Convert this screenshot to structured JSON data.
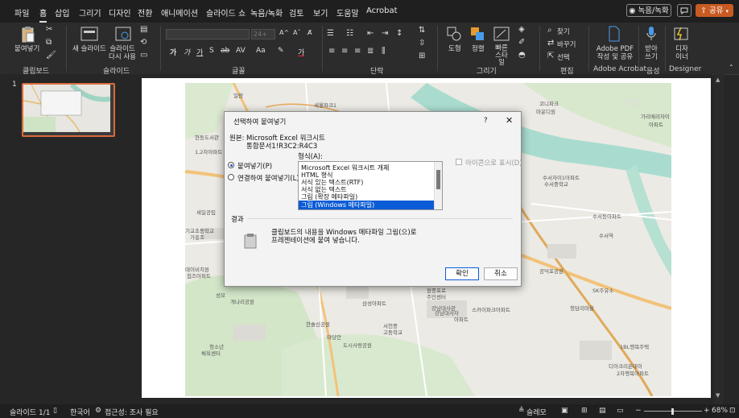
{
  "menubar": {
    "items": [
      "파일",
      "홈",
      "삽입",
      "그리기",
      "디자인",
      "전환",
      "애니메이션",
      "슬라이드 쇼",
      "녹음/녹화",
      "검토",
      "보기",
      "도움말",
      "Acrobat"
    ],
    "active_index": 1,
    "record_label": "◉ 녹음/녹화",
    "comment_icon": "comment-icon",
    "share_label": "공유"
  },
  "ribbon": {
    "groups": {
      "clipboard": "클립보드",
      "slides": "슬라이드",
      "font": "글꼴",
      "paragraph": "단락",
      "drawing": "그리기",
      "editing": "편집",
      "acrobat": "Adobe Acrobat",
      "voice": "음성",
      "designer": "Designer"
    },
    "paste_label": "붙여넣기",
    "new_slide_label": "새 슬라이드",
    "reuse_slides_label": "슬라이드 다시 사용",
    "font_size_value": "24+",
    "shapes_label": "도형",
    "arrange_label": "정렬",
    "quick_styles_label": "빠른 스타일",
    "find_label": "찾기",
    "replace_label": "바꾸기",
    "select_label": "선택",
    "adobe_pdf_label": "Adobe PDF 작성 및 공유",
    "dictate_label": "받아쓰기",
    "designer_label": "디자이너"
  },
  "thumbs": {
    "slide_number": "1"
  },
  "dialog": {
    "title": "선택하여 붙여넣기",
    "help": "?",
    "source_label": "원본:",
    "source_line1": "Microsoft Excel 워크시트",
    "source_line2": "통합문서1!R3C2:R4C3",
    "format_label": "형식(A):",
    "radio_paste": "붙여넣기(P)",
    "radio_link": "연결하여 붙여넣기(L)",
    "formats": [
      "Microsoft Excel 워크시트 개체",
      "HTML 형식",
      "서식 있는 텍스트(RTF)",
      "서식 없는 텍스트",
      "그림 (확장 메타파일)",
      "그림 (Windows 메타파일)"
    ],
    "selected_format_index": 5,
    "display_as_icon": "아이콘으로 표시(D)",
    "result_label": "결과",
    "result_text_line1": "클립보드의 내용을 Windows 메타파일 그림(으)로",
    "result_text_line2": "프레젠테이션에 붙여 넣습니다.",
    "ok_label": "확인",
    "cancel_label": "취소"
  },
  "map": {
    "labels": [
      "세월파크1",
      "두산아파트",
      "일람",
      "현동도서관",
      "1,2차아파트",
      "세일공립",
      "기교초등학교",
      "가흥조",
      "데이비치원",
      "첩즈아파트",
      "성모",
      "개나리공원",
      "원종포로",
      "주민센터",
      "삼성아파트",
      "한솔신공원",
      "청소년",
      "체육센터",
      "마당안",
      "도시사랑공원",
      "서천중",
      "고등학교",
      "강남대사관",
      "강남대사자",
      "아파트",
      "스카이파크아파트",
      "수서역",
      "SK주유소",
      "청담리마을",
      "1BL행복주택",
      "디아크리온데이",
      "2차행복아파트",
      "가리메리자이",
      "아파트",
      "수서자이1아파트",
      "수서중학교",
      "마운디원",
      "코니파크",
      "수서동아파트",
      "공덕포공원",
      "가르"
    ]
  },
  "statusbar": {
    "slide_info": "슬라이드 1/1",
    "language": "한국어",
    "accessibility": "접근성: 조사 필요",
    "notes": "슬레모",
    "zoom": "68%"
  }
}
